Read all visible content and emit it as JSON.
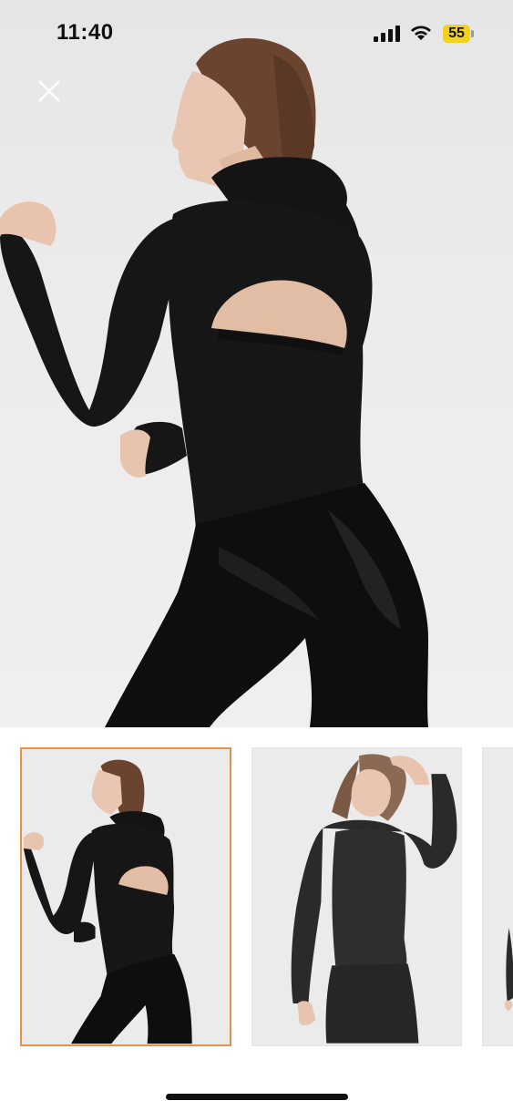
{
  "status_bar": {
    "time": "11:40",
    "battery_level": "55",
    "icons": [
      "signal-icon",
      "wifi-icon",
      "battery-icon"
    ]
  },
  "viewer": {
    "close_icon": "close-icon",
    "selected_thumbnail_index": 0,
    "thumbnail_count_visible": 3,
    "accent_color": "#e8914a"
  },
  "colors": {
    "garment": "#141414",
    "background": "#ececec",
    "battery": "#f2d21c"
  }
}
